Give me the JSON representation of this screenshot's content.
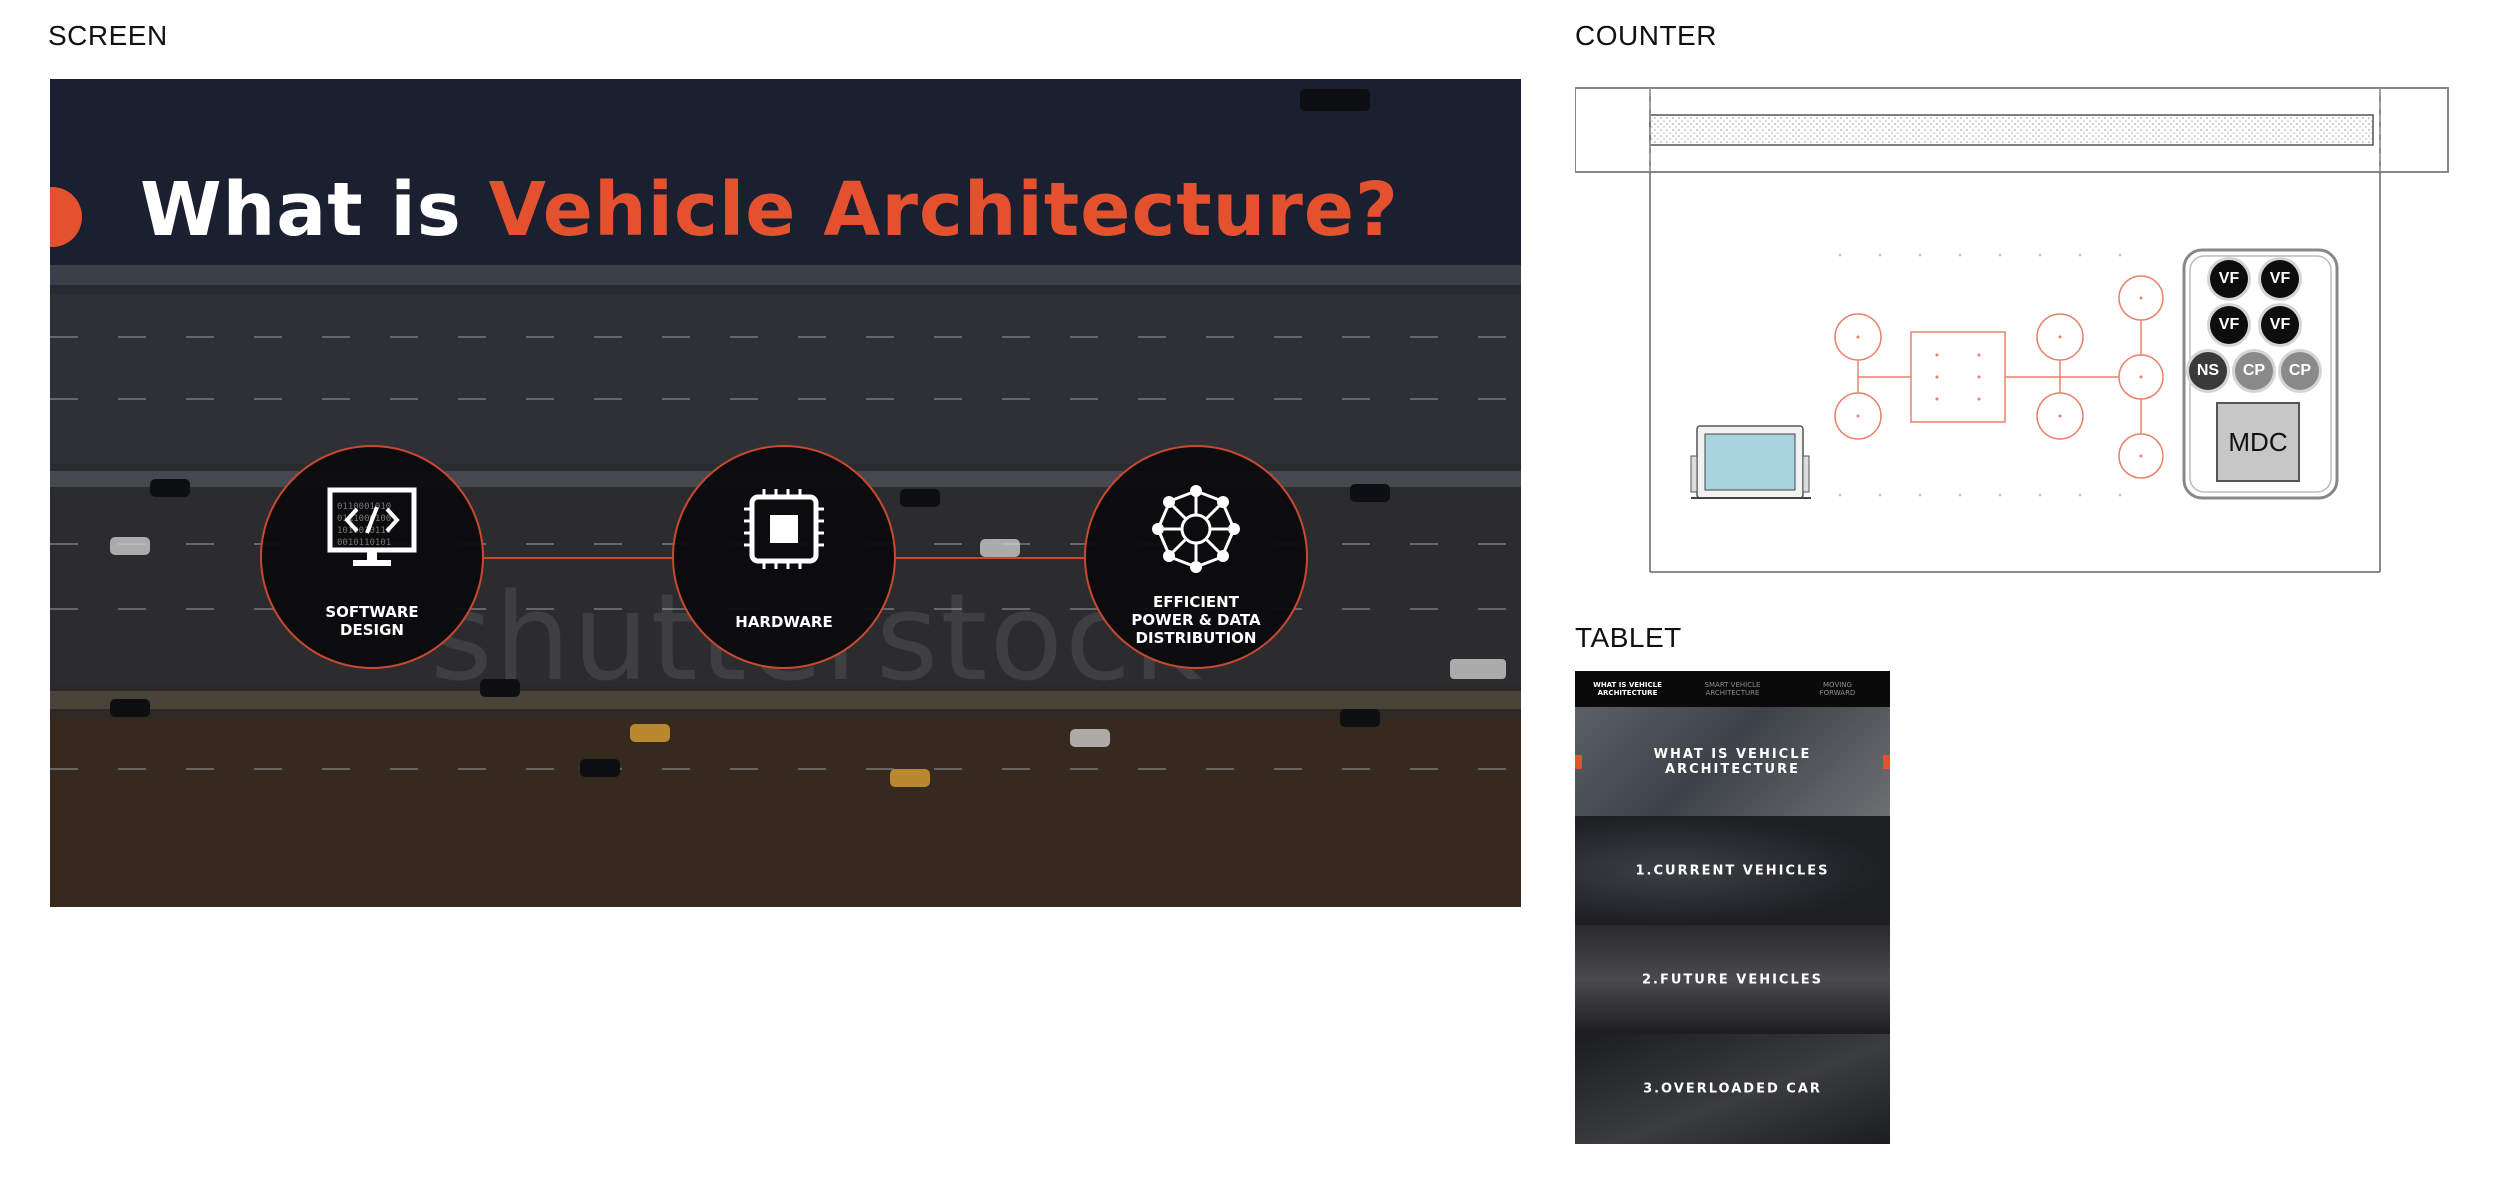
{
  "sections": {
    "screen": "SCREEN",
    "counter": "COUNTER",
    "tablet": "TABLET"
  },
  "screen": {
    "title_prefix": "What is ",
    "title_accent": "Vehicle Architecture?",
    "watermark": "shutterstock",
    "accent_color": "#e4512f",
    "features": [
      {
        "label": "SOFTWARE\nDESIGN",
        "icon": "code-monitor-icon"
      },
      {
        "label": "HARDWARE",
        "icon": "chip-icon"
      },
      {
        "label": "EFFICIENT\nPOWER & DATA\nDISTRIBUTION",
        "icon": "network-hub-icon"
      }
    ]
  },
  "counter": {
    "buttons": [
      "VF",
      "VF",
      "VF",
      "VF",
      "NS",
      "CP",
      "CP"
    ],
    "mdc_label": "MDC"
  },
  "tablet": {
    "nav": [
      {
        "label": "WHAT IS VEHICLE\nARCHITECTURE",
        "active": true
      },
      {
        "label": "SMART VEHICLE\nARCHITECTURE",
        "active": false
      },
      {
        "label": "MOVING\nFORWARD",
        "active": false
      }
    ],
    "tiles": [
      "WHAT IS VEHICLE\nARCHITECTURE",
      "1.CURRENT VEHICLES",
      "2.FUTURE VEHICLES",
      "3.OVERLOADED CAR"
    ]
  }
}
